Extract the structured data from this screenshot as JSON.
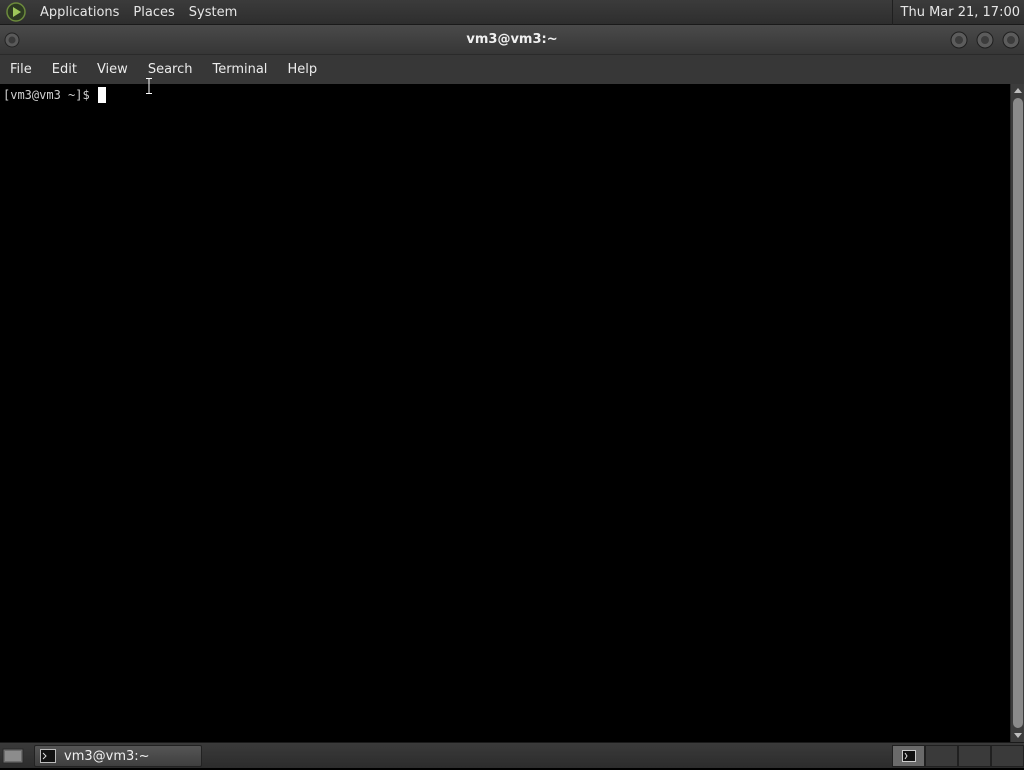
{
  "top_panel": {
    "menus": [
      {
        "label": "Applications"
      },
      {
        "label": "Places"
      },
      {
        "label": "System"
      }
    ],
    "clock": "Thu Mar 21, 17:00"
  },
  "window": {
    "title": "vm3@vm3:~",
    "menus": [
      {
        "label": "File"
      },
      {
        "label": "Edit"
      },
      {
        "label": "View"
      },
      {
        "label": "Search"
      },
      {
        "label": "Terminal"
      },
      {
        "label": "Help"
      }
    ]
  },
  "terminal": {
    "prompt": "[vm3@vm3 ~]$"
  },
  "taskbar": {
    "task_label": "vm3@vm3:~",
    "workspaces": 4,
    "active_workspace": 1
  },
  "colors": {
    "panel": "#2e2e2e",
    "terminal_bg": "#000000",
    "terminal_fg": "#d0d0d0"
  }
}
